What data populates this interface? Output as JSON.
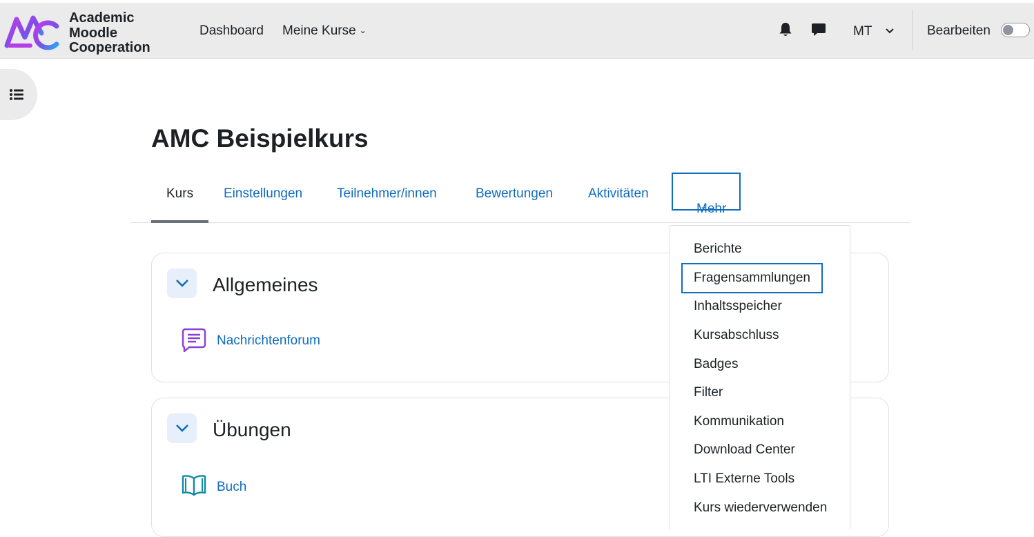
{
  "brand": {
    "line1": "Academic",
    "line2": "Moodle",
    "line3": "Cooperation",
    "gradient_start": "#7b3fe4",
    "gradient_end": "#2aa5f5"
  },
  "navbar": {
    "links": [
      {
        "label": "Dashboard"
      },
      {
        "label": "Meine Kurse",
        "icon": "chevron-down-icon"
      }
    ],
    "notifications_icon": "bell-icon",
    "messages_icon": "chat-bubble-icon",
    "user_initials": "MT",
    "edit_mode_label": "Bearbeiten",
    "edit_mode_on": false
  },
  "drawer": {
    "icon": "list-icon"
  },
  "course": {
    "title": "AMC Beispielkurs"
  },
  "secondary_nav": {
    "tabs": [
      {
        "label": "Kurs",
        "active": true
      },
      {
        "label": "Einstellungen"
      },
      {
        "label": "Teilnehmer/innen"
      },
      {
        "label": "Bewertungen"
      },
      {
        "label": "Aktivitäten"
      }
    ],
    "more": {
      "label": "Mehr",
      "icon": "chevron-down-icon"
    }
  },
  "more_menu": {
    "items": [
      {
        "label": "Berichte"
      },
      {
        "label": "Fragensammlungen",
        "highlighted": true
      },
      {
        "label": "Inhaltsspeicher"
      },
      {
        "label": "Kursabschluss"
      },
      {
        "label": "Badges"
      },
      {
        "label": "Filter"
      },
      {
        "label": "Kommunikation"
      },
      {
        "label": "Download Center"
      },
      {
        "label": "LTI Externe Tools"
      },
      {
        "label": "Kurs wiederverwenden"
      }
    ]
  },
  "sections": [
    {
      "title": "Allgemeines",
      "activities": [
        {
          "label": "Nachrichtenforum",
          "icon": "forum-icon",
          "icon_color": "#8b3fd6"
        }
      ]
    },
    {
      "title": "Übungen",
      "activities": [
        {
          "label": "Buch",
          "icon": "book-icon",
          "icon_color": "#0e8aa6"
        }
      ]
    }
  ]
}
